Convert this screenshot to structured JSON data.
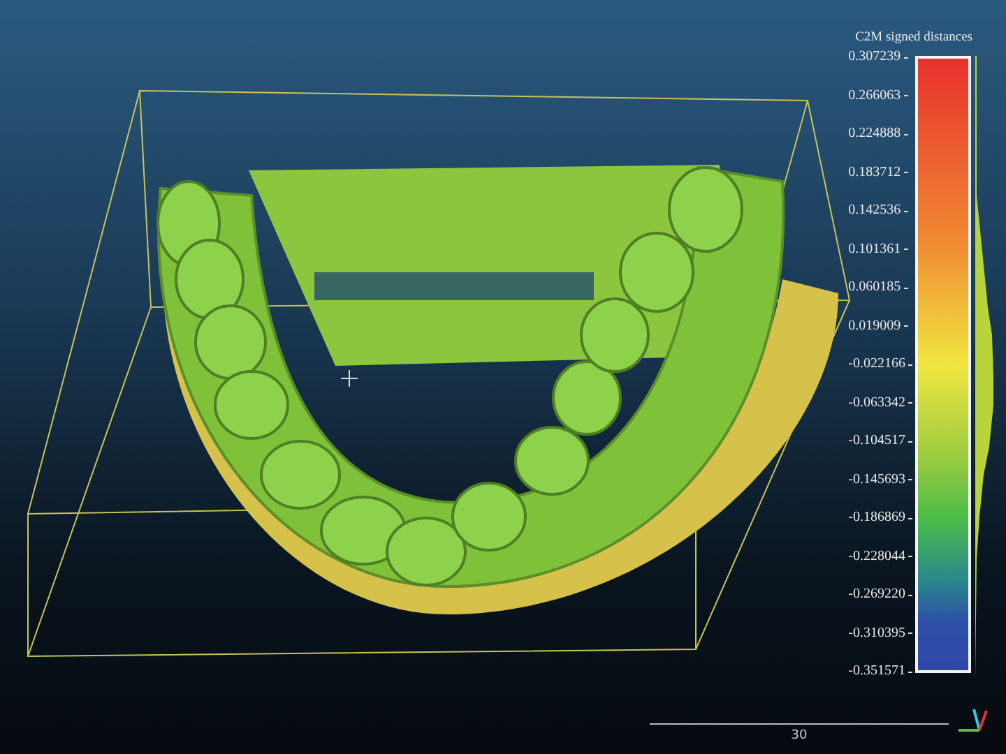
{
  "viewport": {
    "color_scale": {
      "title": "C2M signed distances",
      "labels": [
        "0.307239",
        "0.266063",
        "0.224888",
        "0.183712",
        "0.142536",
        "0.101361",
        "0.060185",
        "0.019009",
        "-0.022166",
        "-0.063342",
        "-0.104517",
        "-0.145693",
        "-0.186869",
        "-0.228044",
        "-0.269220",
        "-0.310395",
        "-0.351571"
      ]
    },
    "scale_bar": {
      "label": "30"
    }
  }
}
